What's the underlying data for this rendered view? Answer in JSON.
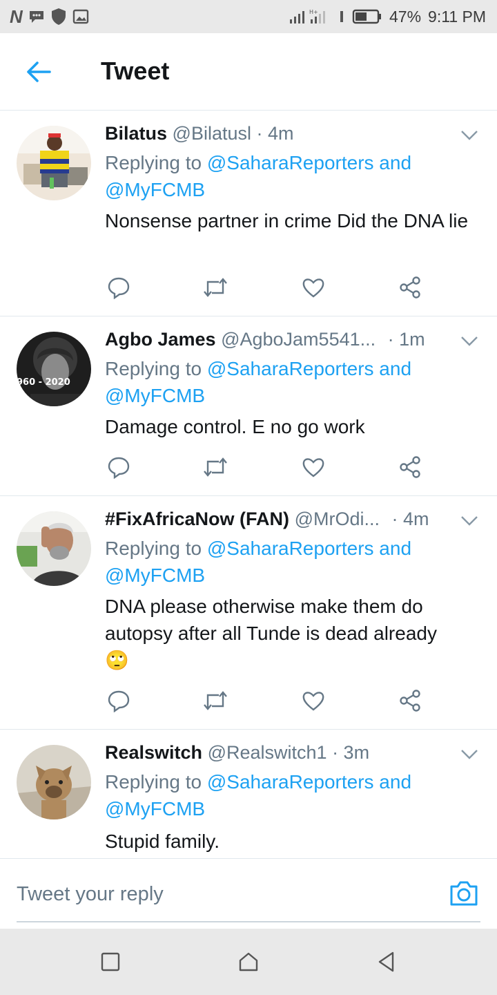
{
  "status_bar": {
    "left_icons": [
      "n-icon",
      "message-icon",
      "shield-icon",
      "image-icon"
    ],
    "battery": "47%",
    "time": "9:11 PM"
  },
  "header": {
    "title": "Tweet"
  },
  "tweets": [
    {
      "name": "Bilatus",
      "handle": "@Bilatusl",
      "time": "· 4m",
      "replying_label": "Replying to",
      "mention1": "@SaharaReporters and",
      "mention2": "@MyFCMB",
      "text": "Nonsense partner in crime Did the DNA lie"
    },
    {
      "name": "Agbo James",
      "handle": "@AgboJam5541...",
      "time": "· 1m",
      "replying_label": "Replying to",
      "mention1": "@SaharaReporters and",
      "mention2": "@MyFCMB",
      "text": "Damage control. E no go work",
      "avatar_caption": "960 - 2020"
    },
    {
      "name": "#FixAfricaNow (FAN)",
      "handle": "@MrOdi...",
      "time": "· 4m",
      "replying_label": "Replying to",
      "mention1": "@SaharaReporters and",
      "mention2": "@MyFCMB",
      "text": "DNA please otherwise make them do autopsy after all Tunde is dead already",
      "emoji": "🙄"
    },
    {
      "name": "Realswitch",
      "handle": "@Realswitch1",
      "time": "· 3m",
      "replying_label": "Replying to",
      "mention1": "@SaharaReporters and",
      "mention2": "@MyFCMB",
      "text": "Stupid family."
    }
  ],
  "reply_bar": {
    "placeholder": "Tweet your reply"
  },
  "colors": {
    "accent": "#1da1f2",
    "icon_gray": "#657786",
    "text": "#14171a"
  }
}
